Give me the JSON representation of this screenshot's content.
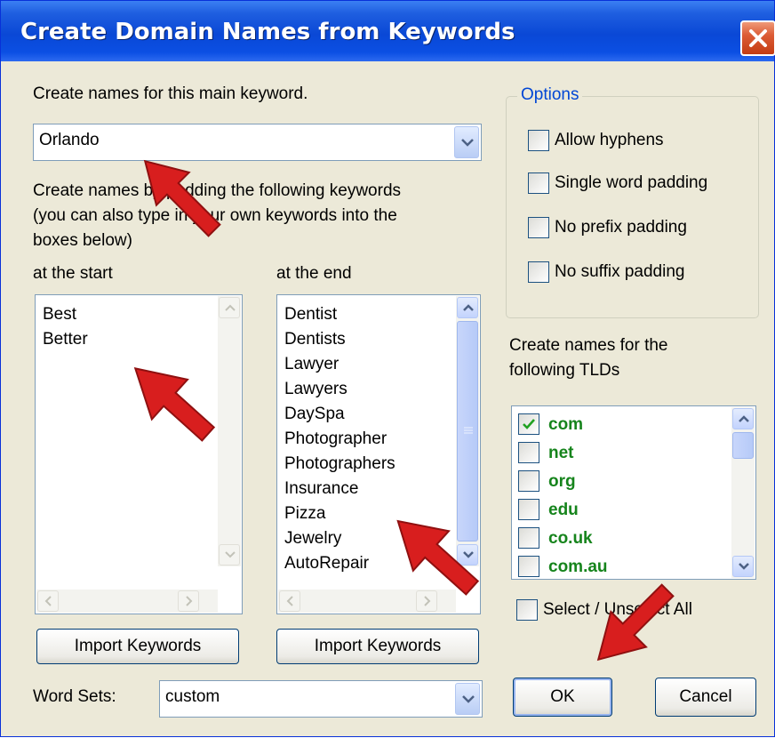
{
  "window": {
    "title": "Create Domain Names from Keywords"
  },
  "main_keyword": {
    "label": "Create names for this main keyword.",
    "value": "Orlando"
  },
  "padding_help": {
    "line1": "Create names by padding the following keywords",
    "line2": "(you can also type in your own keywords into the",
    "line3": "boxes below)"
  },
  "start_list": {
    "label": "at the start",
    "items": [
      "Best",
      "Better"
    ]
  },
  "end_list": {
    "label": "at the end",
    "items": [
      "Dentist",
      "Dentists",
      "Lawyer",
      "Lawyers",
      "DaySpa",
      "Photographer",
      "Photographers",
      "Insurance",
      "Pizza",
      "Jewelry",
      "AutoRepair"
    ]
  },
  "import_start_label": "Import Keywords",
  "import_end_label": "Import Keywords",
  "word_sets": {
    "label": "Word Sets:",
    "value": "custom"
  },
  "options": {
    "legend": "Options",
    "items": [
      {
        "label": "Allow hyphens",
        "checked": false
      },
      {
        "label": "Single word padding",
        "checked": false
      },
      {
        "label": "No prefix padding",
        "checked": false
      },
      {
        "label": "No suffix padding",
        "checked": false
      }
    ]
  },
  "tld": {
    "label_line1": "Create names for the",
    "label_line2": "following TLDs",
    "items": [
      {
        "label": "com",
        "checked": true
      },
      {
        "label": "net",
        "checked": false
      },
      {
        "label": "org",
        "checked": false
      },
      {
        "label": "edu",
        "checked": false
      },
      {
        "label": "co.uk",
        "checked": false
      },
      {
        "label": "com.au",
        "checked": false
      }
    ],
    "select_all_label": "Select / Unselect All"
  },
  "ok_label": "OK",
  "cancel_label": "Cancel",
  "colors": {
    "title_blue": "#0a48d6",
    "window_bg": "#ece9d8",
    "tld_green": "#16841c",
    "options_blue": "#0046d5",
    "arrow_red": "#d81e1e"
  }
}
